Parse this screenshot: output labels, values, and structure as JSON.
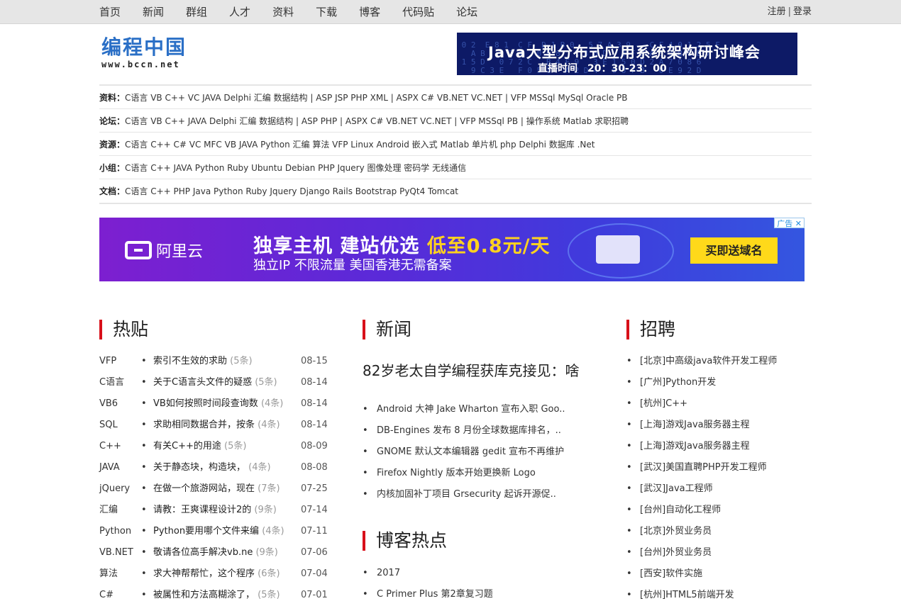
{
  "topnav": [
    "首页",
    "新闻",
    "群组",
    "人才",
    "资料",
    "下载",
    "博客",
    "代码贴",
    "论坛"
  ],
  "auth": {
    "register": "注册",
    "sep": "|",
    "login": "登录"
  },
  "logo": {
    "name": "编程中国",
    "url": "www.bccn.net"
  },
  "banner_top": {
    "title": "Java大型分布式应用系统架构研讨峰会",
    "time": "直播时间　20：30-23：00"
  },
  "categories": [
    {
      "label": "资料：",
      "text": "C语言 VB C++ VC JAVA Delphi 汇编 数据结构 | ASP JSP PHP XML | ASPX C# VB.NET VC.NET | VFP MSSql MySql Oracle PB"
    },
    {
      "label": "论坛：",
      "text": "C语言 VB C++ JAVA Delphi 汇编 数据结构 | ASP PHP | ASPX C# VB.NET VC.NET | VFP MSSql PB | 操作系统 Matlab 求职招聘"
    },
    {
      "label": "资源：",
      "text": "C语言 C++ C# VC MFC VB JAVA Python 汇编 算法 VFP Linux Android 嵌入式 Matlab 单片机 php Delphi 数据库 .Net"
    },
    {
      "label": "小组：",
      "text": "C语言 C++ JAVA Python Ruby Ubuntu Debian PHP Jquery 图像处理 密码学 无线通信"
    },
    {
      "label": "文档：",
      "text": "C语言 C++ PHP Java Python Ruby Jquery Django Rails Bootstrap PyQt4 Tomcat"
    }
  ],
  "banner_ali": {
    "ad_tag": "广告",
    "brand": "阿里云",
    "headline_a": "独享主机 建站优选 ",
    "headline_b": "低至0.8元/天",
    "sub": "独立IP 不限流量 美国香港无需备案",
    "cta": "买即送域名"
  },
  "sections": {
    "hot": "热贴",
    "news": "新闻",
    "jobs": "招聘",
    "blog": "博客热点"
  },
  "hot_posts": [
    {
      "cat": "VFP",
      "title": "索引不生效的求助",
      "count": "(5条)",
      "date": "08-15"
    },
    {
      "cat": "C语言",
      "title": "关于C语言头文件的疑惑",
      "count": "(5条)",
      "date": "08-14"
    },
    {
      "cat": "VB6",
      "title": "VB如何按照时间段查询数",
      "count": "(4条)",
      "date": "08-14"
    },
    {
      "cat": "SQL",
      "title": "求助相同数据合并，按条",
      "count": "(4条)",
      "date": "08-14"
    },
    {
      "cat": "C++",
      "title": "有关C++的用途",
      "count": "(5条)",
      "date": "08-09"
    },
    {
      "cat": "JAVA",
      "title": "关于静态块，构造块，",
      "count": "(4条)",
      "date": "08-08"
    },
    {
      "cat": "jQuery",
      "title": "在做一个旅游网站，现在",
      "count": "(7条)",
      "date": "07-25"
    },
    {
      "cat": "汇编",
      "title": "请教：王爽课程设计2的",
      "count": "(9条)",
      "date": "07-14"
    },
    {
      "cat": "Python",
      "title": "Python要用哪个文件来编",
      "count": "(4条)",
      "date": "07-11"
    },
    {
      "cat": "VB.NET",
      "title": "敬请各位高手解决vb.ne",
      "count": "(9条)",
      "date": "07-06"
    },
    {
      "cat": "算法",
      "title": "求大神帮帮忙，这个程序",
      "count": "(6条)",
      "date": "07-04"
    },
    {
      "cat": "C#",
      "title": "被属性和方法高糊涂了，",
      "count": "(5条)",
      "date": "07-01"
    }
  ],
  "news_headline": "82岁老太自学编程获库克接见：啥",
  "news": [
    "Android 大神 Jake Wharton 宣布入职 Goo..",
    "DB-Engines 发布 8 月份全球数据库排名，..",
    "GNOME 默认文本编辑器 gedit 宣布不再维护",
    "Firefox Nightly 版本开始更换新 Logo",
    "内核加固补丁项目 Grsecurity 起诉开源促.."
  ],
  "blog": [
    "2017",
    "C Primer Plus 第2章复习题"
  ],
  "jobs": [
    "[北京]中高级java软件开发工程师",
    "[广州]Python开发",
    "[杭州]C++",
    "[上海]游戏Java服务器主程",
    "[上海]游戏Java服务器主程",
    "[武汉]美国直聘PHP开发工程师",
    "[武汉]Java工程师",
    "[台州]自动化工程师",
    "[北京]外贸业务员",
    "[台州]外贸业务员",
    "[西安]软件实施",
    "[杭州]HTML5前端开发"
  ]
}
